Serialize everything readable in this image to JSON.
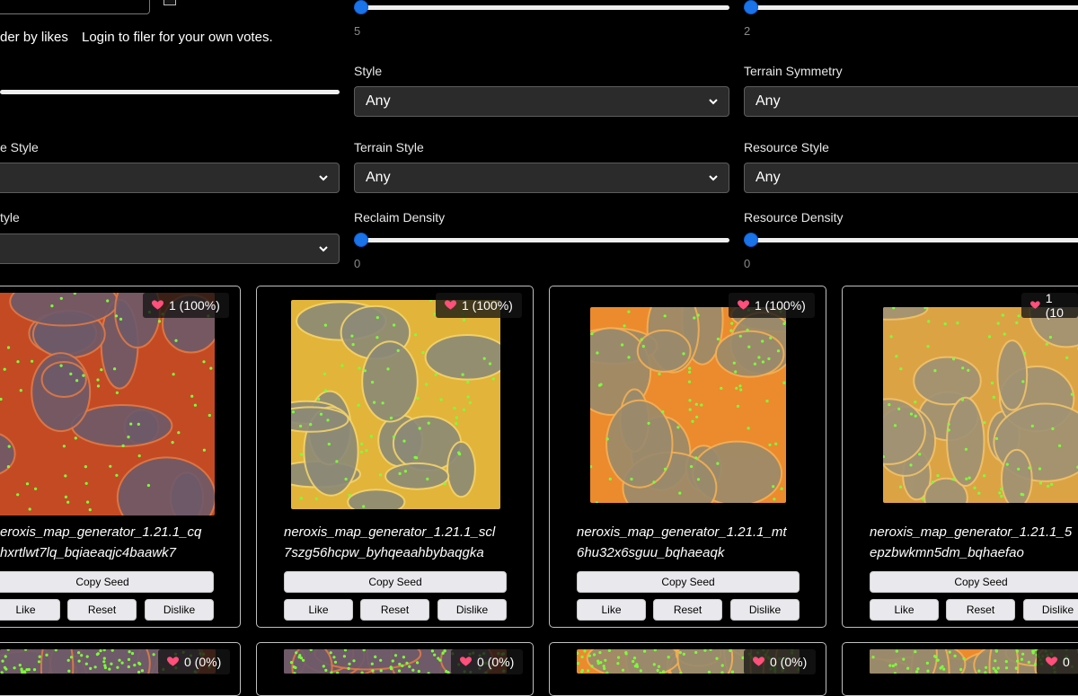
{
  "filters": {
    "order_by_likes_label": "der by likes",
    "login_hint": "Login to filer for your own votes.",
    "slider1_value": "5",
    "slider2_value": "2",
    "style_label": "Style",
    "style_value": "Any",
    "terrain_symmetry_label": "Terrain Symmetry",
    "terrain_symmetry_value": "Any",
    "left_style2_label": "e Style",
    "terrain_style_label": "Terrain Style",
    "terrain_style_value": "Any",
    "resource_style_label": "Resource Style",
    "resource_style_value": "Any",
    "left_style3_label": "tyle",
    "reclaim_density_label": "Reclaim Density",
    "reclaim_density_value": "0",
    "resource_density_label": "Resource Density",
    "resource_density_value": "0"
  },
  "cards": [
    {
      "likes": "1 (100%)",
      "name1": "eroxis_map_generator_1.21.1_cq",
      "name2": "hxrtlwt7lq_bqiaeaqjc4baawk7",
      "copy": "Copy Seed",
      "like": "Like",
      "reset": "Reset",
      "dislike": "Dislike",
      "palette": "red"
    },
    {
      "likes": "1 (100%)",
      "name1": "neroxis_map_generator_1.21.1_scl",
      "name2": "7szg56hcpw_byhqeaahbybaqgka",
      "copy": "Copy Seed",
      "like": "Like",
      "reset": "Reset",
      "dislike": "Dislike",
      "palette": "yellow"
    },
    {
      "likes": "1 (100%)",
      "name1": "neroxis_map_generator_1.21.1_mt",
      "name2": "6hu32x6sguu_bqhaeaqk",
      "copy": "Copy Seed",
      "like": "Like",
      "reset": "Reset",
      "dislike": "Dislike",
      "palette": "orange"
    },
    {
      "likes": "1 (10",
      "name1": "neroxis_map_generator_1.21.1_5",
      "name2": "epzbwkmn5dm_bqhaefao",
      "copy": "Copy Seed",
      "like": "Like",
      "reset": "Reset",
      "dislike": "Dislike",
      "palette": "sand"
    }
  ],
  "second_row_likes": [
    "0 (0%)",
    "0 (0%)",
    "0 (0%)",
    "0"
  ],
  "colors": {
    "accent": "#1a73e8",
    "heart": "#ff4f7b"
  }
}
